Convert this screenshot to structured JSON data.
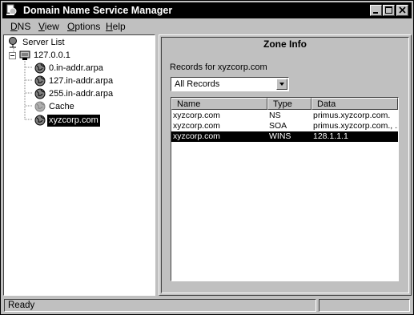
{
  "window": {
    "title": "Domain Name Service Manager"
  },
  "menu": [
    {
      "label": "DNS",
      "mnemonic": "D",
      "rest": "NS"
    },
    {
      "label": "View",
      "mnemonic": "V",
      "rest": "iew"
    },
    {
      "label": "Options",
      "mnemonic": "O",
      "rest": "ptions"
    },
    {
      "label": "Help",
      "mnemonic": "H",
      "rest": "elp"
    }
  ],
  "tree": {
    "root": "Server List",
    "server": "127.0.0.1",
    "zones": [
      "0.in-addr.arpa",
      "127.in-addr.arpa",
      "255.in-addr.arpa",
      "Cache",
      "xyzcorp.com"
    ],
    "selected_zone": "xyzcorp.com"
  },
  "zone_info": {
    "title": "Zone Info",
    "records_label": "Records for xyzcorp.com",
    "filter_value": "All Records",
    "columns": [
      "Name",
      "Type",
      "Data"
    ],
    "records": [
      {
        "name": "xyzcorp.com",
        "type": "NS",
        "data": "primus.xyzcorp.com."
      },
      {
        "name": "xyzcorp.com",
        "type": "SOA",
        "data": "primus.xyzcorp.com., ..."
      },
      {
        "name": "xyzcorp.com",
        "type": "WINS",
        "data": "128.1.1.1"
      }
    ],
    "selected_record_index": 2
  },
  "status": {
    "text": "Ready"
  },
  "icons": {
    "app": "dns-manager-icon",
    "root": "server-list-icon",
    "server": "server-icon",
    "zone": "globe-icon"
  }
}
